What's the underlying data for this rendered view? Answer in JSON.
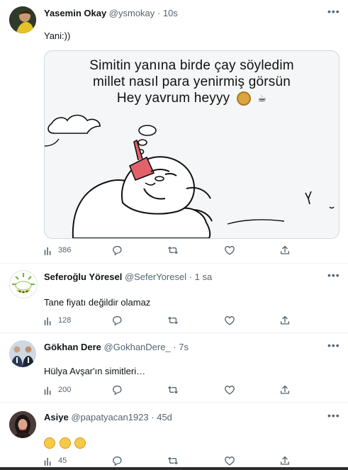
{
  "tweets": [
    {
      "name": "Yasemin Okay",
      "meta": "@ysmokay · 10s",
      "text": "Yani:))",
      "stats": {
        "views": "386"
      },
      "media": {
        "line1": "Simitin yanına birde çay söyledim",
        "line2": "millet nasıl para yenirmiş görsün",
        "line3": "Hey yavrum heyyy"
      }
    },
    {
      "name": "Seferoğlu Yöresel",
      "meta": "@SeferYoresel · 1 sa",
      "text": "Tane fiyatı değildir olamaz",
      "stats": {
        "views": "128"
      }
    },
    {
      "name": "Gökhan Dere",
      "meta": "@GokhanDere_ · 7s",
      "text": "Hülya Avşar'ın simitleri…",
      "stats": {
        "views": "200"
      }
    },
    {
      "name": "Asiye",
      "meta": "@papatyacan1923 · 45d",
      "text": "",
      "stats": {
        "views": "45"
      }
    }
  ],
  "icons": {
    "more": "more-icon",
    "views": "views-icon",
    "reply": "reply-icon",
    "retweet": "retweet-icon",
    "like": "like-icon",
    "share": "share-icon"
  },
  "colors": {
    "secondary": "#536471",
    "divider": "#eff3f4"
  }
}
